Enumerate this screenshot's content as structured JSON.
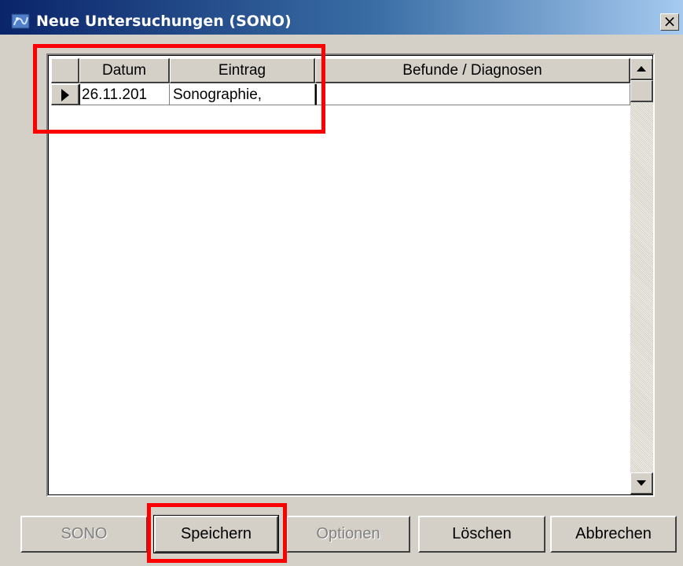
{
  "window": {
    "title": "Neue Untersuchungen (SONO)",
    "close_glyph": "×"
  },
  "grid": {
    "columns": [
      "Datum",
      "Eintrag",
      "Befunde / Diagnosen"
    ],
    "rows": [
      {
        "datum": "26.11.201",
        "eintrag": "Sonographie,",
        "befunde": ""
      }
    ]
  },
  "buttons": {
    "sono": "SONO",
    "speichern": "Speichern",
    "optionen": "Optionen",
    "loeschen": "Löschen",
    "abbrechen": "Abbrechen"
  },
  "colors": {
    "titlebar_start": "#0a246a",
    "titlebar_end": "#a6caf0",
    "highlight": "#ff0000",
    "face": "#d4d0c8"
  }
}
